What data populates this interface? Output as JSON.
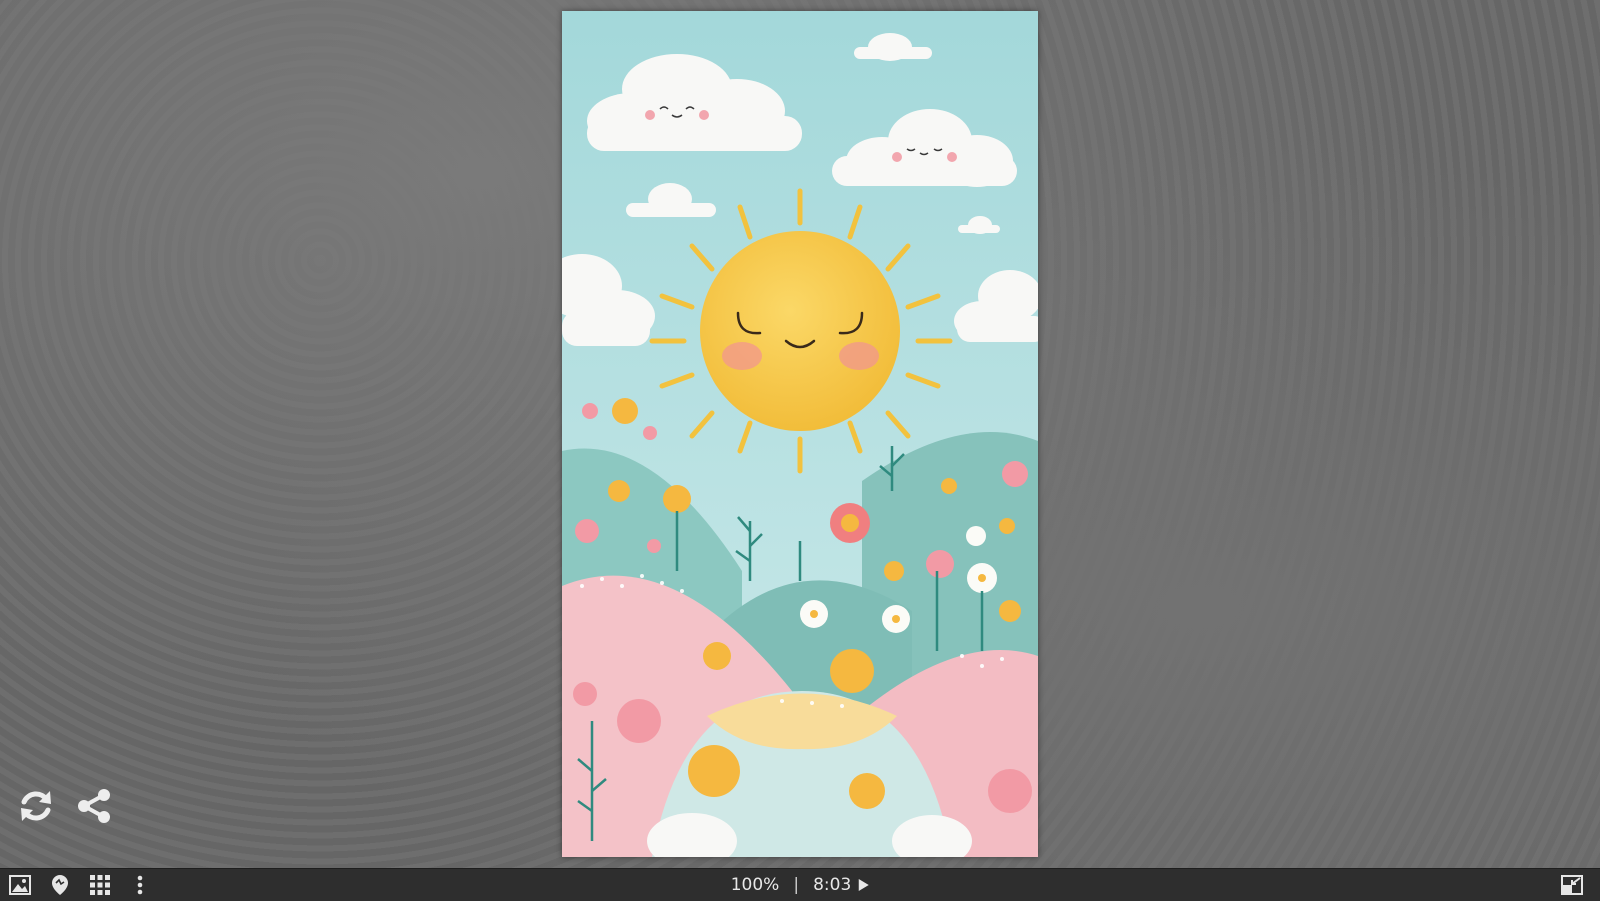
{
  "viewer": {
    "zoom": "100%",
    "separator": "|",
    "time": "8:03"
  },
  "icons": {
    "refresh": "refresh-icon",
    "share": "share-icon",
    "image": "image-icon",
    "location": "location-pin-icon",
    "grid": "grid-icon",
    "more": "more-vertical-icon",
    "play": "play-icon",
    "fullscreen": "fullscreen-exit-icon"
  },
  "colors": {
    "taskbar": "#2e2e2e",
    "background": "#6a6a6a",
    "sky": "#a8dadb",
    "sun": "#f7c948",
    "hill_teal": "#86c4be",
    "hill_pink": "#f3bcc4"
  }
}
